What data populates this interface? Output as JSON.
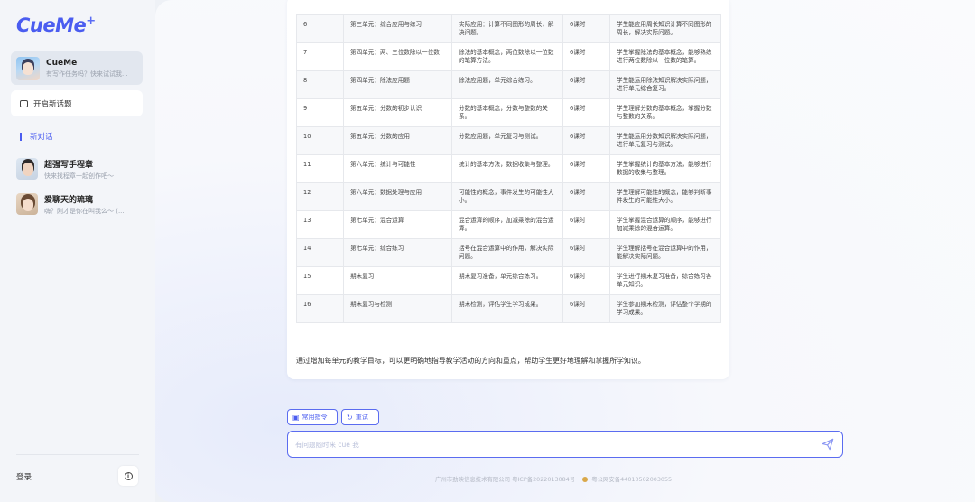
{
  "app": {
    "logo": "CueMe",
    "logo_mark": "+"
  },
  "sidebar": {
    "active_chat": {
      "name": "CueMe",
      "preview": "有写作任务吗？快来试试我..."
    },
    "new_topic_label": "开启新话题",
    "section_label": "新对话",
    "bots": [
      {
        "name": "超强写手程章",
        "preview": "快来找程章一起创作吧～"
      },
      {
        "name": "爱聊天的琉璃",
        "preview": "嗨？刚才是你在叫我么～ (..."
      }
    ],
    "login_label": "登录"
  },
  "table": {
    "rows": [
      [
        "6",
        "第三单元：综合应用与练习",
        "实际应用：计算不同图形的周长，解决问题。",
        "6课时",
        "学生能应用周长知识计算不同图形的周长，解决实际问题。"
      ],
      [
        "7",
        "第四单元：两、三位数除以一位数",
        "除法的基本概念，两位数除以一位数的笔算方法。",
        "6课时",
        "学生掌握除法的基本概念，能够熟练进行两位数除以一位数的笔算。"
      ],
      [
        "8",
        "第四单元：除法应用题",
        "除法应用题，单元综合练习。",
        "6课时",
        "学生能运用除法知识解决实际问题，进行单元综合复习。"
      ],
      [
        "9",
        "第五单元：分数的初步认识",
        "分数的基本概念，分数与整数的关系。",
        "6课时",
        "学生理解分数的基本概念，掌握分数与整数的关系。"
      ],
      [
        "10",
        "第五单元：分数的应用",
        "分数应用题，单元复习与测试。",
        "6课时",
        "学生能运用分数知识解决实际问题，进行单元复习与测试。"
      ],
      [
        "11",
        "第六单元：统计与可能性",
        "统计的基本方法，数据收集与整理。",
        "6课时",
        "学生掌握统计的基本方法，能够进行数据的收集与整理。"
      ],
      [
        "12",
        "第六单元：数据处理与应用",
        "可能性的概念，事件发生的可能性大小。",
        "6课时",
        "学生理解可能性的概念，能够判断事件发生的可能性大小。"
      ],
      [
        "13",
        "第七单元：混合运算",
        "混合运算的顺序，加减乘除的混合运算。",
        "6课时",
        "学生掌握混合运算的顺序，能够进行加减乘除的混合运算。"
      ],
      [
        "14",
        "第七单元：综合练习",
        "括号在混合运算中的作用，解决实际问题。",
        "6课时",
        "学生理解括号在混合运算中的作用，能解决实际问题。"
      ],
      [
        "15",
        "期末复习",
        "期末复习准备，单元综合练习。",
        "6课时",
        "学生进行期末复习准备，综合练习各单元知识。"
      ],
      [
        "16",
        "期末复习与检测",
        "期末检测，评估学生学习成果。",
        "6课时",
        "学生参加期末检测，评估整个学期的学习成果。"
      ]
    ]
  },
  "summary": "通过增加每单元的教学目标，可以更明确地指导教学活动的方向和重点，帮助学生更好地理解和掌握所学知识。",
  "actions": {
    "common_commands": "常用指令",
    "retry": "重试"
  },
  "input": {
    "placeholder": "有问题随时来 cue 我",
    "value": ""
  },
  "footer": {
    "company": "广州市劲映信息技术有限公司 粤ICP备2022013084号",
    "police": "粤公网安备44010502003055"
  },
  "colors": {
    "accent": "#4a5cf0",
    "sidebar_bg": "#f3f5f9",
    "active_bg": "#e2e7ef"
  },
  "icons": [
    "chat-plus-icon",
    "info-icon",
    "command-icon",
    "refresh-icon",
    "send-icon",
    "police-badge-icon"
  ]
}
